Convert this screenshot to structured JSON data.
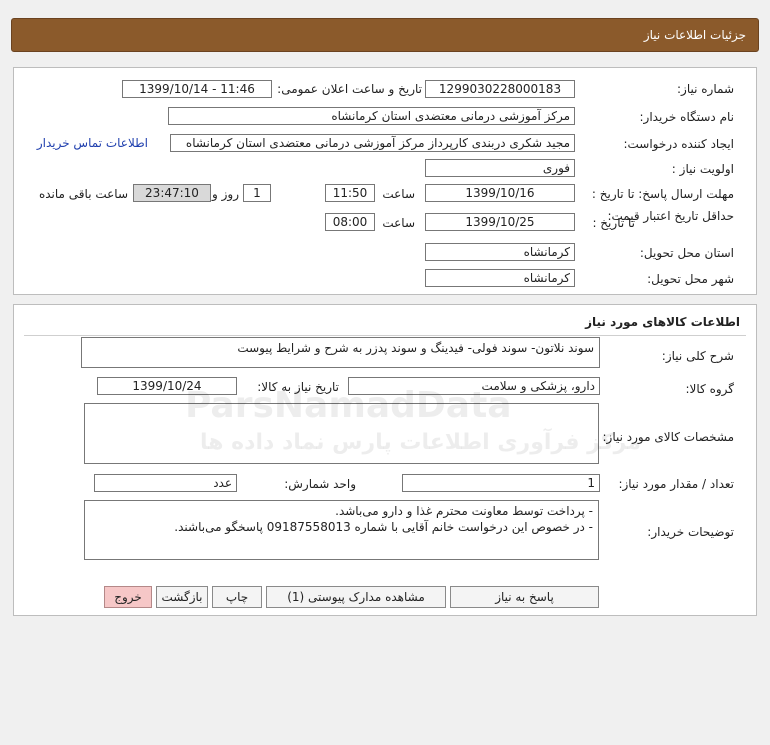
{
  "header": {
    "title": "جزئیات اطلاعات نیاز"
  },
  "details": {
    "need_number_label": "شماره نیاز:",
    "need_number": "1299030228000183",
    "announce_label": "تاریخ و ساعت اعلان عمومی:",
    "announce_value": "1399/10/14 - 11:46",
    "buyer_label": "نام دستگاه خریدار:",
    "buyer_value": "مرکز آموزشی درمانی معتضدی استان کرمانشاه",
    "creator_label": "ایجاد کننده درخواست:",
    "creator_value": "مجید شکری دربندی کارپرداز مرکز آموزشی درمانی معتضدی استان کرمانشاه",
    "contact_link": "اطلاعات تماس خریدار",
    "priority_label": "اولویت نیاز :",
    "priority_value": "فوری",
    "deadline_label": "مهلت ارسال پاسخ: تا تاریخ :",
    "deadline_date": "1399/10/16",
    "time_label": "ساعت",
    "deadline_time": "11:50",
    "days_value": "1",
    "days_label": "روز و",
    "remaining_time": "23:47:10",
    "remaining_label": "ساعت باقی مانده",
    "validity_label": "حداقل تاریخ اعتبار قیمت:",
    "validity_until_label": "تا تاریخ :",
    "validity_date": "1399/10/25",
    "validity_time_label": "ساعت",
    "validity_time": "08:00",
    "province_label": "استان محل تحویل:",
    "province_value": "کرمانشاه",
    "city_label": "شهر محل تحویل:",
    "city_value": "کرمانشاه"
  },
  "goods": {
    "section_title": "اطلاعات کالاهای مورد نیاز",
    "summary_label": "شرح کلی نیاز:",
    "summary_value": "سوند نلاتون- سوند فولی- فیدینگ و سوند پدزر به شرح و شرایط پیوست",
    "group_label": "گروه کالا:",
    "group_value": "دارو، پزشکی و سلامت",
    "need_date_label": "تاریخ نیاز به کالا:",
    "need_date_value": "1399/10/24",
    "specs_label": "مشخصات کالای مورد نیاز:",
    "specs_value": "",
    "qty_label": "تعداد / مقدار مورد نیاز:",
    "qty_value": "1",
    "unit_label": "واحد شمارش:",
    "unit_value": "عدد",
    "notes_label": "توضیحات خریدار:",
    "notes_line1": "- پرداخت توسط معاونت محترم غذا و دارو می‌باشد.",
    "notes_line2": "- در خصوص این درخواست خانم آقایی با شماره 09187558013 پاسخگو می‌باشند."
  },
  "buttons": {
    "reply": "پاسخ به نیاز",
    "attachments": "مشاهده مدارک پیوستی (1)",
    "print": "چاپ",
    "back": "بازگشت",
    "exit": "خروج"
  },
  "watermark": {
    "main": "ParsNamadData",
    "sub": "مرکز فرآوری اطلاعات پارس نماد داده ها"
  }
}
